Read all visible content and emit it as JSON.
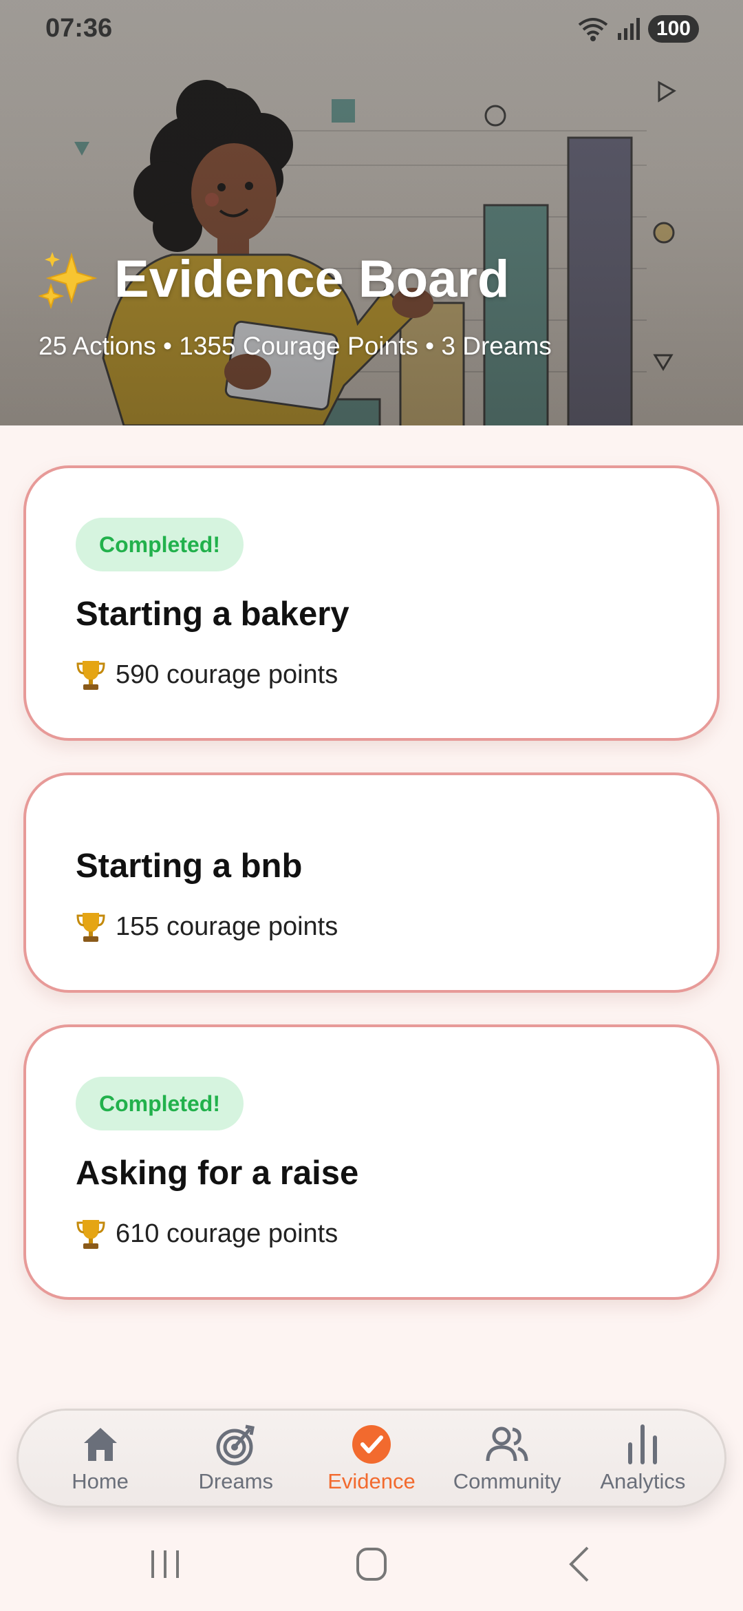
{
  "status_bar": {
    "time": "07:36",
    "battery": "100",
    "icons": [
      "wifi-icon",
      "signal-icon",
      "battery-icon"
    ]
  },
  "header": {
    "title": "Evidence Board",
    "subtitle": "25 Actions • 1355 Courage Points • 3 Dreams",
    "illustration": "person-with-tablet-and-bar-chart"
  },
  "cards": [
    {
      "badge": "Completed!",
      "title": "Starting a bakery",
      "points": "590 courage points"
    },
    {
      "badge": "",
      "title": "Starting a bnb",
      "points": "155 courage points"
    },
    {
      "badge": "Completed!",
      "title": "Asking for a raise",
      "points": "610 courage points"
    }
  ],
  "bottom_nav": {
    "items": [
      {
        "label": "Home",
        "icon": "home-icon"
      },
      {
        "label": "Dreams",
        "icon": "target-icon"
      },
      {
        "label": "Evidence",
        "icon": "check-circle-icon",
        "active": true
      },
      {
        "label": "Community",
        "icon": "people-icon"
      },
      {
        "label": "Analytics",
        "icon": "bar-chart-icon"
      }
    ]
  },
  "colors": {
    "accent": "#f26a2e",
    "card_border": "#e79a98",
    "badge_bg": "#d6f4df",
    "badge_text": "#22b14c",
    "background": "#fdf4f2"
  }
}
